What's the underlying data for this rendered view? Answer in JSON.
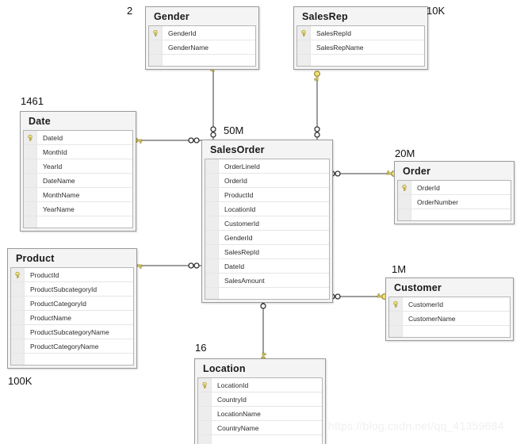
{
  "diagram": {
    "type": "database-schema-erd",
    "watermark": "https://blog.csdn.net/qq_41359684",
    "key_icon_name": "primary-key-icon",
    "colors": {
      "table_border": "#9a9a9a",
      "table_header_bg": "#f4f4f4",
      "field_bg": "#ffffff",
      "gutter_bg": "#ededed",
      "connector": "#9d9d9d",
      "key_gold": "#e8d24a"
    },
    "tables": [
      {
        "id": "gender",
        "name": "Gender",
        "row_count": "2",
        "fields": [
          {
            "name": "GenderId",
            "is_key": true
          },
          {
            "name": "GenderName",
            "is_key": false
          }
        ]
      },
      {
        "id": "salesrep",
        "name": "SalesRep",
        "row_count": "10K",
        "fields": [
          {
            "name": "SalesRepId",
            "is_key": true
          },
          {
            "name": "SalesRepName",
            "is_key": false
          }
        ]
      },
      {
        "id": "date",
        "name": "Date",
        "row_count": "1461",
        "fields": [
          {
            "name": "DateId",
            "is_key": true
          },
          {
            "name": "MonthId",
            "is_key": false
          },
          {
            "name": "YearId",
            "is_key": false
          },
          {
            "name": "DateName",
            "is_key": false
          },
          {
            "name": "MonthName",
            "is_key": false
          },
          {
            "name": "YearName",
            "is_key": false
          }
        ]
      },
      {
        "id": "salesorder",
        "name": "SalesOrder",
        "row_count": "50M",
        "fields": [
          {
            "name": "OrderLineId",
            "is_key": false
          },
          {
            "name": "OrderId",
            "is_key": false
          },
          {
            "name": "ProductId",
            "is_key": false
          },
          {
            "name": "LocationId",
            "is_key": false
          },
          {
            "name": "CustomerId",
            "is_key": false
          },
          {
            "name": "GenderId",
            "is_key": false
          },
          {
            "name": "SalesRepId",
            "is_key": false
          },
          {
            "name": "DateId",
            "is_key": false
          },
          {
            "name": "SalesAmount",
            "is_key": false
          }
        ]
      },
      {
        "id": "order",
        "name": "Order",
        "row_count": "20M",
        "fields": [
          {
            "name": "OrderId",
            "is_key": true
          },
          {
            "name": "OrderNumber",
            "is_key": false
          }
        ]
      },
      {
        "id": "product",
        "name": "Product",
        "row_count": "100K",
        "fields": [
          {
            "name": "ProductId",
            "is_key": true
          },
          {
            "name": "ProductSubcategoryId",
            "is_key": false
          },
          {
            "name": "ProductCategoryId",
            "is_key": false
          },
          {
            "name": "ProductName",
            "is_key": false
          },
          {
            "name": "ProductSubcategoryName",
            "is_key": false
          },
          {
            "name": "ProductCategoryName",
            "is_key": false
          }
        ]
      },
      {
        "id": "customer",
        "name": "Customer",
        "row_count": "1M",
        "fields": [
          {
            "name": "CustomerId",
            "is_key": true
          },
          {
            "name": "CustomerName",
            "is_key": false
          }
        ]
      },
      {
        "id": "location",
        "name": "Location",
        "row_count": "16",
        "fields": [
          {
            "name": "LocationId",
            "is_key": true
          },
          {
            "name": "CountryId",
            "is_key": false
          },
          {
            "name": "LocationName",
            "is_key": false
          },
          {
            "name": "CountryName",
            "is_key": false
          }
        ]
      }
    ],
    "relationships": [
      {
        "id": "rel-gender-salesorder",
        "one": "Gender",
        "many": "SalesOrder"
      },
      {
        "id": "rel-salesrep-salesorder",
        "one": "SalesRep",
        "many": "SalesOrder"
      },
      {
        "id": "rel-date-salesorder",
        "one": "Date",
        "many": "SalesOrder"
      },
      {
        "id": "rel-product-salesorder",
        "one": "Product",
        "many": "SalesOrder"
      },
      {
        "id": "rel-salesorder-order",
        "one": "Order",
        "many": "SalesOrder"
      },
      {
        "id": "rel-salesorder-customer",
        "one": "Customer",
        "many": "SalesOrder"
      },
      {
        "id": "rel-location-salesorder",
        "one": "Location",
        "many": "SalesOrder"
      }
    ]
  }
}
